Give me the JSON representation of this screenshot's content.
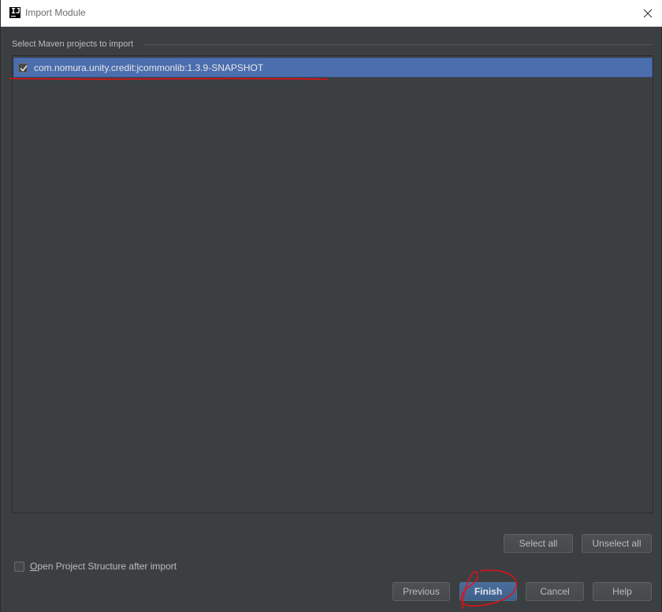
{
  "window": {
    "title": "Import Module"
  },
  "section": {
    "label": "Select Maven projects to import"
  },
  "projects": [
    {
      "label": "com.nomura.unity.credit:jcommonlib:1.3.9-SNAPSHOT",
      "checked": true
    }
  ],
  "buttons": {
    "select_all": "Select all",
    "unselect_all": "Unselect all",
    "previous": "Previous",
    "finish": "Finish",
    "cancel": "Cancel",
    "help": "Help"
  },
  "option": {
    "mnemonic": "O",
    "rest": "pen Project Structure after import",
    "checked": false
  },
  "colors": {
    "background": "#3c3f41",
    "selection": "#4b6eaf",
    "annotation": "#e0101a",
    "default_button": "#41618c"
  },
  "icons": {
    "app": "intellij-app-icon",
    "close": "close-icon",
    "check": "checkmark-icon"
  }
}
